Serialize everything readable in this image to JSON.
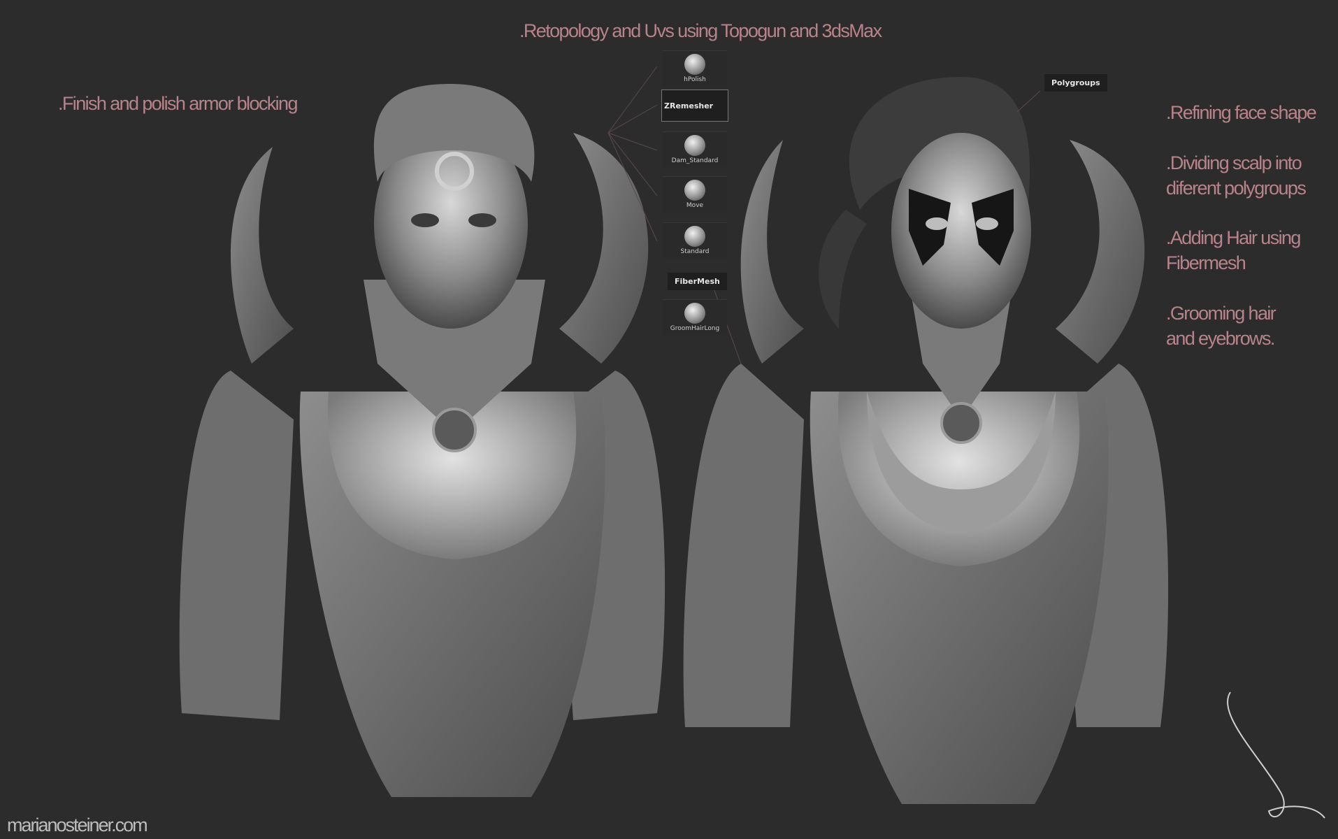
{
  "annotations": {
    "title": ".Retopology and Uvs using Topogun and 3dsMax",
    "left_note": ".Finish and polish armor blocking",
    "right_notes": [
      ".Refining face shape",
      ".Dividing scalp into diferent polygroups",
      ".Adding Hair using Fibermesh",
      ".Grooming hair and eyebrows."
    ]
  },
  "brushes": [
    {
      "label": "hPolish"
    },
    {
      "label": "ZRemesher"
    },
    {
      "label": "Dam_Standard"
    },
    {
      "label": "Move"
    },
    {
      "label": "Standard"
    },
    {
      "label": "FiberMesh"
    },
    {
      "label": "GroomHairLong"
    }
  ],
  "tags": {
    "polygroups": "Polygroups"
  },
  "watermark": "marianosteiner.com",
  "colors": {
    "background": "#2c2c2c",
    "annotation_text": "#b9838c",
    "sculpt_grey": "#8c8c8c"
  }
}
